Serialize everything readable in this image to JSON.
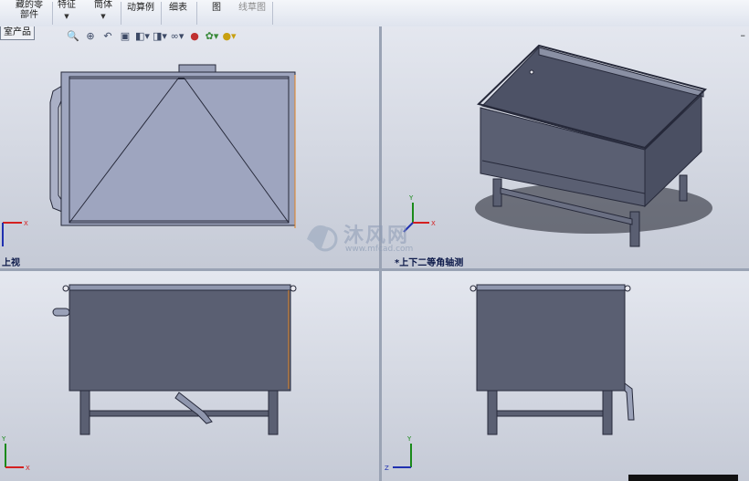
{
  "ribbon": {
    "items": [
      {
        "label": "藏的零\n部件",
        "dim": false
      },
      {
        "label": "特征",
        "dim": false
      },
      {
        "label": "筒体",
        "dim": false
      },
      {
        "label": "动算例",
        "dim": false
      },
      {
        "label": "细表",
        "dim": false
      },
      {
        "label": "图",
        "dim": false
      },
      {
        "label": "线草图",
        "dim": true
      }
    ]
  },
  "tree_tab": {
    "label": "室产品"
  },
  "hud_icons": [
    "zoom-to-fit-icon",
    "zoom-area-icon",
    "previous-view-icon",
    "section-view-icon",
    "view-orientation-icon",
    "display-style-icon",
    "hide-show-icon",
    "edit-appearance-icon",
    "apply-scene-icon",
    "view-settings-icon"
  ],
  "viewports": {
    "top": {
      "label": "上视"
    },
    "iso": {
      "label": "*上下二等角轴测"
    },
    "front": {
      "label": ""
    },
    "right": {
      "label": ""
    }
  },
  "watermark": {
    "text": "沐风网",
    "url": "www.mfcad.com"
  },
  "colors": {
    "body": "#5a5f72",
    "edge": "#26293a",
    "shadow": "#1c1e28",
    "axis_x": "#d42020",
    "axis_y": "#1a8a1a",
    "axis_z": "#2030b0"
  }
}
